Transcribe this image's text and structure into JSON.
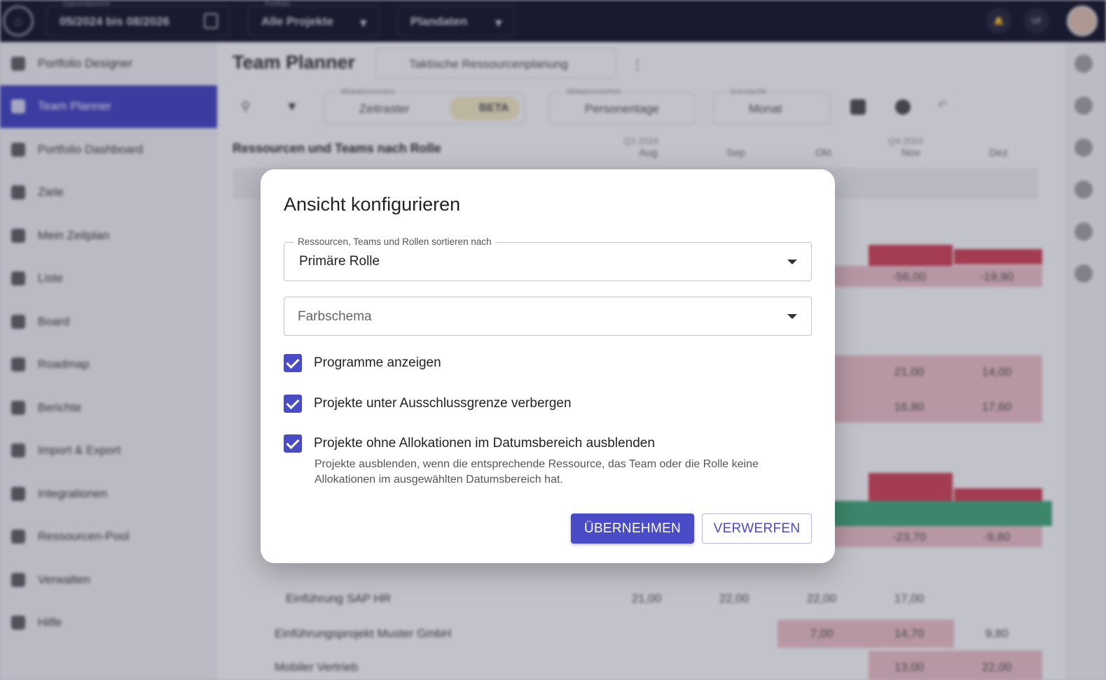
{
  "topbar": {
    "date_range_label": "Datumsbereich",
    "date_range_value": "05/2024 bis 08/2026",
    "portfolio_label": "Portfolio",
    "portfolio_value": "Alle Projekte",
    "plan_value": "Plandaten",
    "user_initials": "VF"
  },
  "sidebar": {
    "items": [
      {
        "label": "Portfolio Designer"
      },
      {
        "label": "Team Planner"
      },
      {
        "label": "Portfolio Dashboard"
      },
      {
        "label": "Ziele"
      },
      {
        "label": "Mein Zeitplan"
      },
      {
        "label": "Liste"
      },
      {
        "label": "Board"
      },
      {
        "label": "Roadmap"
      },
      {
        "label": "Berichte"
      },
      {
        "label": "Import & Export"
      },
      {
        "label": "Integrationen"
      },
      {
        "label": "Ressourcen-Pool"
      },
      {
        "label": "Verwalten"
      },
      {
        "label": "Hilfe"
      }
    ]
  },
  "main": {
    "title": "Team Planner",
    "view_select": "Taktische Ressourcenplanung",
    "toolbar": {
      "allocation_mode_label": "Allokationsmodus",
      "allocation_mode": "Zeitraster",
      "beta": "BETA",
      "allocation_unit_label": "Allokationseinheit",
      "allocation_unit": "Personentage",
      "granularity_label": "Granularität",
      "granularity": "Monat"
    },
    "grid_header": "Ressourcen und Teams nach Rolle",
    "quarters": [
      "Q3 2024",
      "Q4 2024"
    ],
    "months": [
      "Aug",
      "Sep",
      "Okt",
      "Nov",
      "Dez"
    ],
    "rows": [
      {
        "name": "Einführung SAP HR",
        "values": [
          "21,00",
          "22,00",
          "22,00",
          "17,00"
        ]
      },
      {
        "name": "Einführungsprojekt Muster GmbH",
        "values": [
          "7,00",
          "14,70",
          "9,80"
        ]
      },
      {
        "name": "Mobiler Vertrieb",
        "values": [
          "13,00",
          "22,00"
        ]
      }
    ],
    "pink_values": [
      "-56,00",
      "-19,90",
      "21,00",
      "14,00",
      "16,80",
      "17,60",
      "-23,70",
      "-9,80"
    ]
  },
  "dialog": {
    "title": "Ansicht konfigurieren",
    "sort_label": "Ressourcen, Teams und Rollen sortieren nach",
    "sort_value": "Primäre Rolle",
    "color_placeholder": "Farbschema",
    "checkboxes": [
      {
        "label": "Programme anzeigen",
        "checked": true
      },
      {
        "label": "Projekte unter Ausschlussgrenze verbergen",
        "checked": true
      },
      {
        "label": "Projekte ohne Allokationen im Datumsbereich ausblenden",
        "checked": true
      }
    ],
    "help_text": "Projekte ausblenden, wenn die entsprechende Ressource, das Team oder die Rolle keine Allokationen im ausgewählten Datumsbereich hat.",
    "apply_label": "ÜBERNEHMEN",
    "discard_label": "VERWERFEN"
  },
  "colors": {
    "accent": "#4a4bc6",
    "topbar": "#1c1d2e",
    "over_allocation": "#d64a5c",
    "under_allocation": "#4bb07f"
  }
}
